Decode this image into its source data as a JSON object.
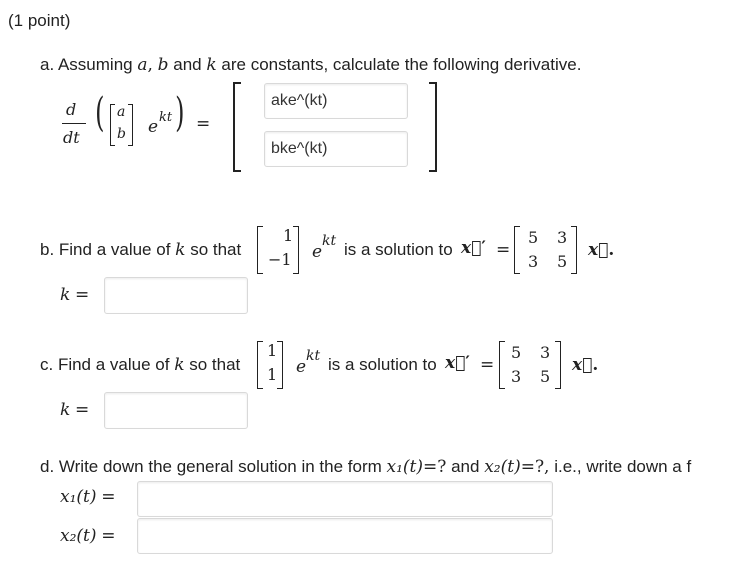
{
  "header": {
    "points": "(1 point)"
  },
  "part_a": {
    "prefix": "a. Assuming",
    "var_a": "a",
    "comma": ",",
    "var_b": "b",
    "and_text": "and",
    "var_k": "k",
    "suffix": "are constants, calculate the following derivative.",
    "deriv_d": "d",
    "deriv_dt": "dt",
    "vec_top": "a",
    "vec_bottom": "b",
    "exp_base": "e",
    "exp_power": "kt",
    "equals": "=",
    "answer_top": "ake^(kt)",
    "answer_bottom": "bke^(kt)"
  },
  "part_b": {
    "prefix": "b. Find a value of",
    "var_k": "k",
    "so_that": "so that",
    "vec_top": "1",
    "vec_bottom": "−1",
    "exp_base": "e",
    "exp_power": "kt",
    "is_solution": "is a solution to",
    "xvec": "x⃗",
    "prime": "′",
    "equals": "=",
    "matrix": [
      [
        "5",
        "3"
      ],
      [
        "3",
        "5"
      ]
    ],
    "rhs_xvec": "x⃗",
    "period": ".",
    "k_label": "k",
    "k_equals": "=",
    "k_value": ""
  },
  "part_c": {
    "prefix": "c. Find a value of",
    "var_k": "k",
    "so_that": "so that",
    "vec_top": "1",
    "vec_bottom": "1",
    "exp_base": "e",
    "exp_power": "kt",
    "is_solution": "is a solution to",
    "xvec": "x⃗",
    "prime": "′",
    "equals": "=",
    "matrix": [
      [
        "5",
        "3"
      ],
      [
        "3",
        "5"
      ]
    ],
    "rhs_xvec": "x⃗",
    "period": ".",
    "k_label": "k",
    "k_equals": "=",
    "k_value": ""
  },
  "part_d": {
    "prefix": "d. Write down the general solution in the form",
    "x1t": "x₁(t)",
    "eq_q1": "=?",
    "and_text": "and",
    "x2t": "x₂(t)",
    "eq_q2": "=?,",
    "suffix": "i.e., write down a f",
    "x1_label": "x₁(t)",
    "x1_equals": "=",
    "x1_value": "",
    "x2_label": "x₂(t)",
    "x2_equals": "=",
    "x2_value": ""
  }
}
